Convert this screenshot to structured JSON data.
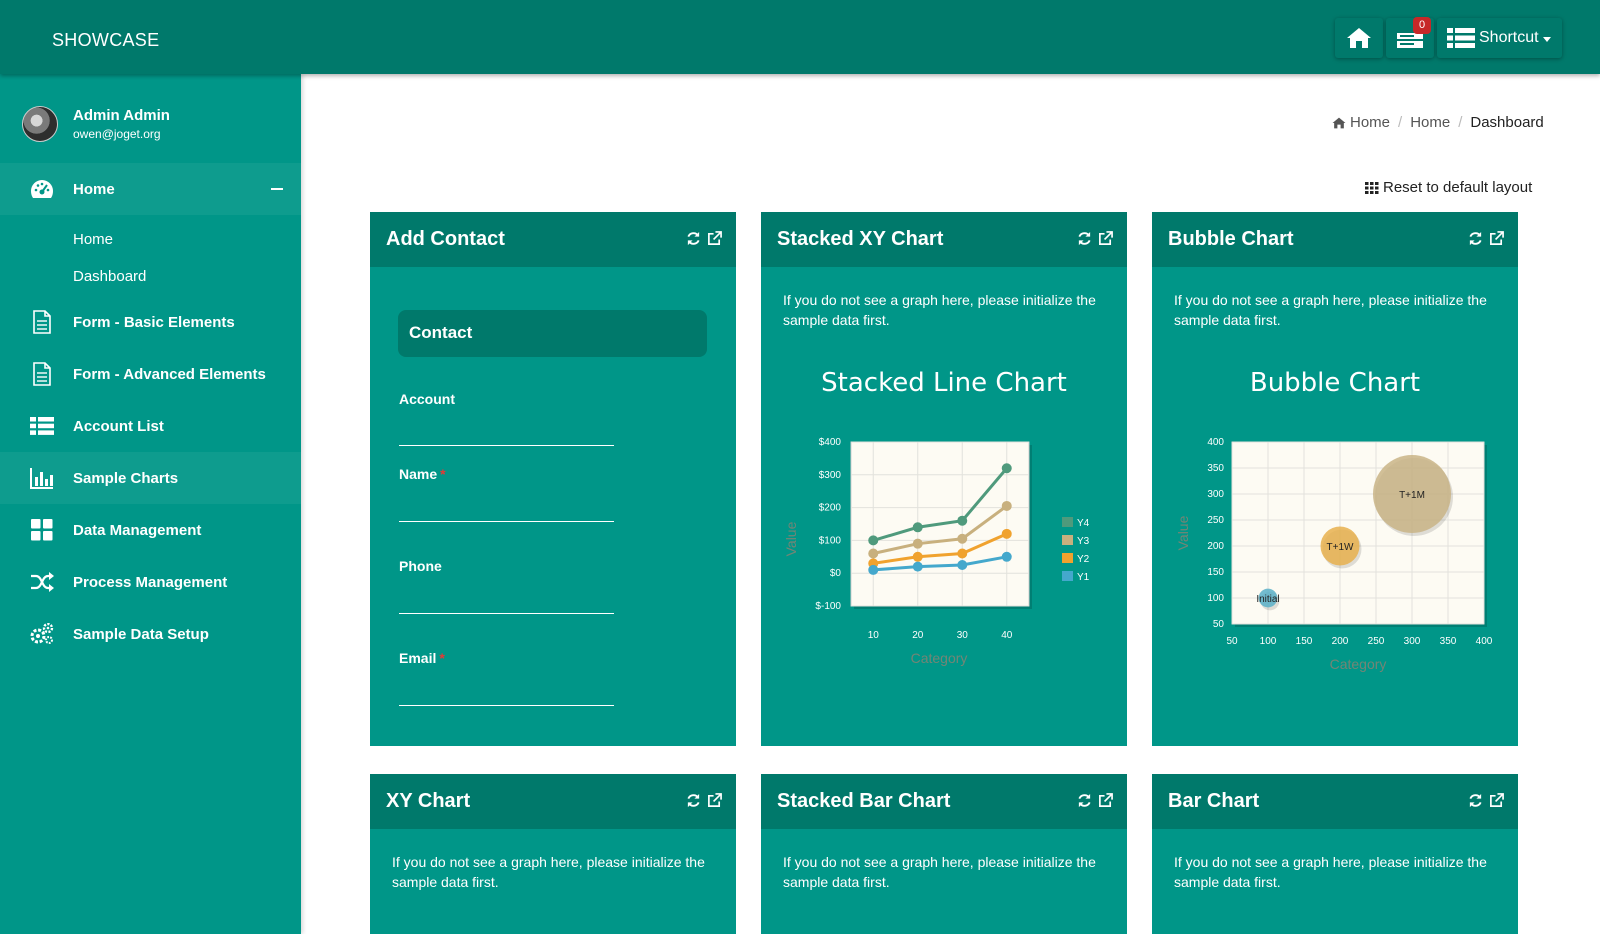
{
  "brand": "SHOWCASE",
  "topbar": {
    "notif_count": "0",
    "shortcut_label": "Shortcut"
  },
  "user": {
    "name": "Admin Admin",
    "email": "owen@joget.org"
  },
  "sidebar": {
    "items": [
      {
        "label": "Home",
        "icon": "dashboard-icon"
      },
      {
        "label": "Form - Basic Elements",
        "icon": "document-icon"
      },
      {
        "label": "Form - Advanced Elements",
        "icon": "document-icon"
      },
      {
        "label": "Account List",
        "icon": "list-icon"
      },
      {
        "label": "Sample Charts",
        "icon": "bar-chart-icon"
      },
      {
        "label": "Data Management",
        "icon": "grid-icon"
      },
      {
        "label": "Process Management",
        "icon": "shuffle-icon"
      },
      {
        "label": "Sample Data Setup",
        "icon": "gears-icon"
      }
    ],
    "subitems": [
      {
        "label": "Home"
      },
      {
        "label": "Dashboard"
      }
    ]
  },
  "breadcrumb": [
    "Home",
    "Home",
    "Dashboard"
  ],
  "reset_label": "Reset to default layout",
  "cards": {
    "add_contact": {
      "title": "Add Contact",
      "section": "Contact",
      "fields": [
        {
          "label": "Account",
          "required": false
        },
        {
          "label": "Name",
          "required": true
        },
        {
          "label": "Phone",
          "required": false
        },
        {
          "label": "Email",
          "required": true
        }
      ]
    },
    "stacked_xy": {
      "title": "Stacked XY Chart",
      "note": "If you do not see a graph here, please initialize the sample data first."
    },
    "bubble": {
      "title": "Bubble Chart",
      "note": "If you do not see a graph here, please initialize the sample data first."
    },
    "xy": {
      "title": "XY Chart",
      "note": "If you do not see a graph here, please initialize the sample data first."
    },
    "stacked_bar": {
      "title": "Stacked Bar Chart",
      "note": "If you do not see a graph here, please initialize the sample data first."
    },
    "bar": {
      "title": "Bar Chart",
      "note": "If you do not see a graph here, please initialize the sample data first."
    }
  },
  "colors": {
    "topbar": "#00796b",
    "sidebar": "#009688",
    "card_body": "#009688",
    "card_head": "#00796b"
  },
  "chart_data": [
    {
      "type": "line",
      "title": "Stacked Line Chart",
      "xlabel": "Category",
      "ylabel": "Value",
      "x": [
        10,
        20,
        30,
        40
      ],
      "y_ticks": [
        "$-100",
        "$0",
        "$100",
        "$200",
        "$300",
        "$400"
      ],
      "ylim": [
        -100,
        400
      ],
      "x_ticks": [
        "10",
        "20",
        "30",
        "40"
      ],
      "grid": true,
      "legend": "right",
      "series": [
        {
          "name": "Y4",
          "color": "#4f9a7c",
          "values": [
            100,
            140,
            160,
            320
          ]
        },
        {
          "name": "Y3",
          "color": "#c8b07e",
          "values": [
            60,
            90,
            105,
            205
          ]
        },
        {
          "name": "Y2",
          "color": "#f0a22e",
          "values": [
            30,
            50,
            60,
            120
          ]
        },
        {
          "name": "Y1",
          "color": "#44a8cc",
          "values": [
            10,
            20,
            25,
            50
          ]
        }
      ]
    },
    {
      "type": "scatter",
      "title": "Bubble Chart",
      "xlabel": "Category",
      "ylabel": "Value",
      "xlim": [
        50,
        400
      ],
      "ylim": [
        50,
        400
      ],
      "x_ticks": [
        "50",
        "100",
        "150",
        "200",
        "250",
        "300",
        "350",
        "400"
      ],
      "y_ticks": [
        "50",
        "100",
        "150",
        "200",
        "250",
        "300",
        "350",
        "400"
      ],
      "grid": true,
      "bubbles": [
        {
          "label": "Initial",
          "x": 100,
          "y": 100,
          "size": 12,
          "color": "#5bb0c8"
        },
        {
          "label": "T+1W",
          "x": 200,
          "y": 200,
          "size": 25,
          "color": "#e8b04e"
        },
        {
          "label": "T+1M",
          "x": 300,
          "y": 300,
          "size": 50,
          "color": "#c9b486"
        }
      ]
    }
  ]
}
